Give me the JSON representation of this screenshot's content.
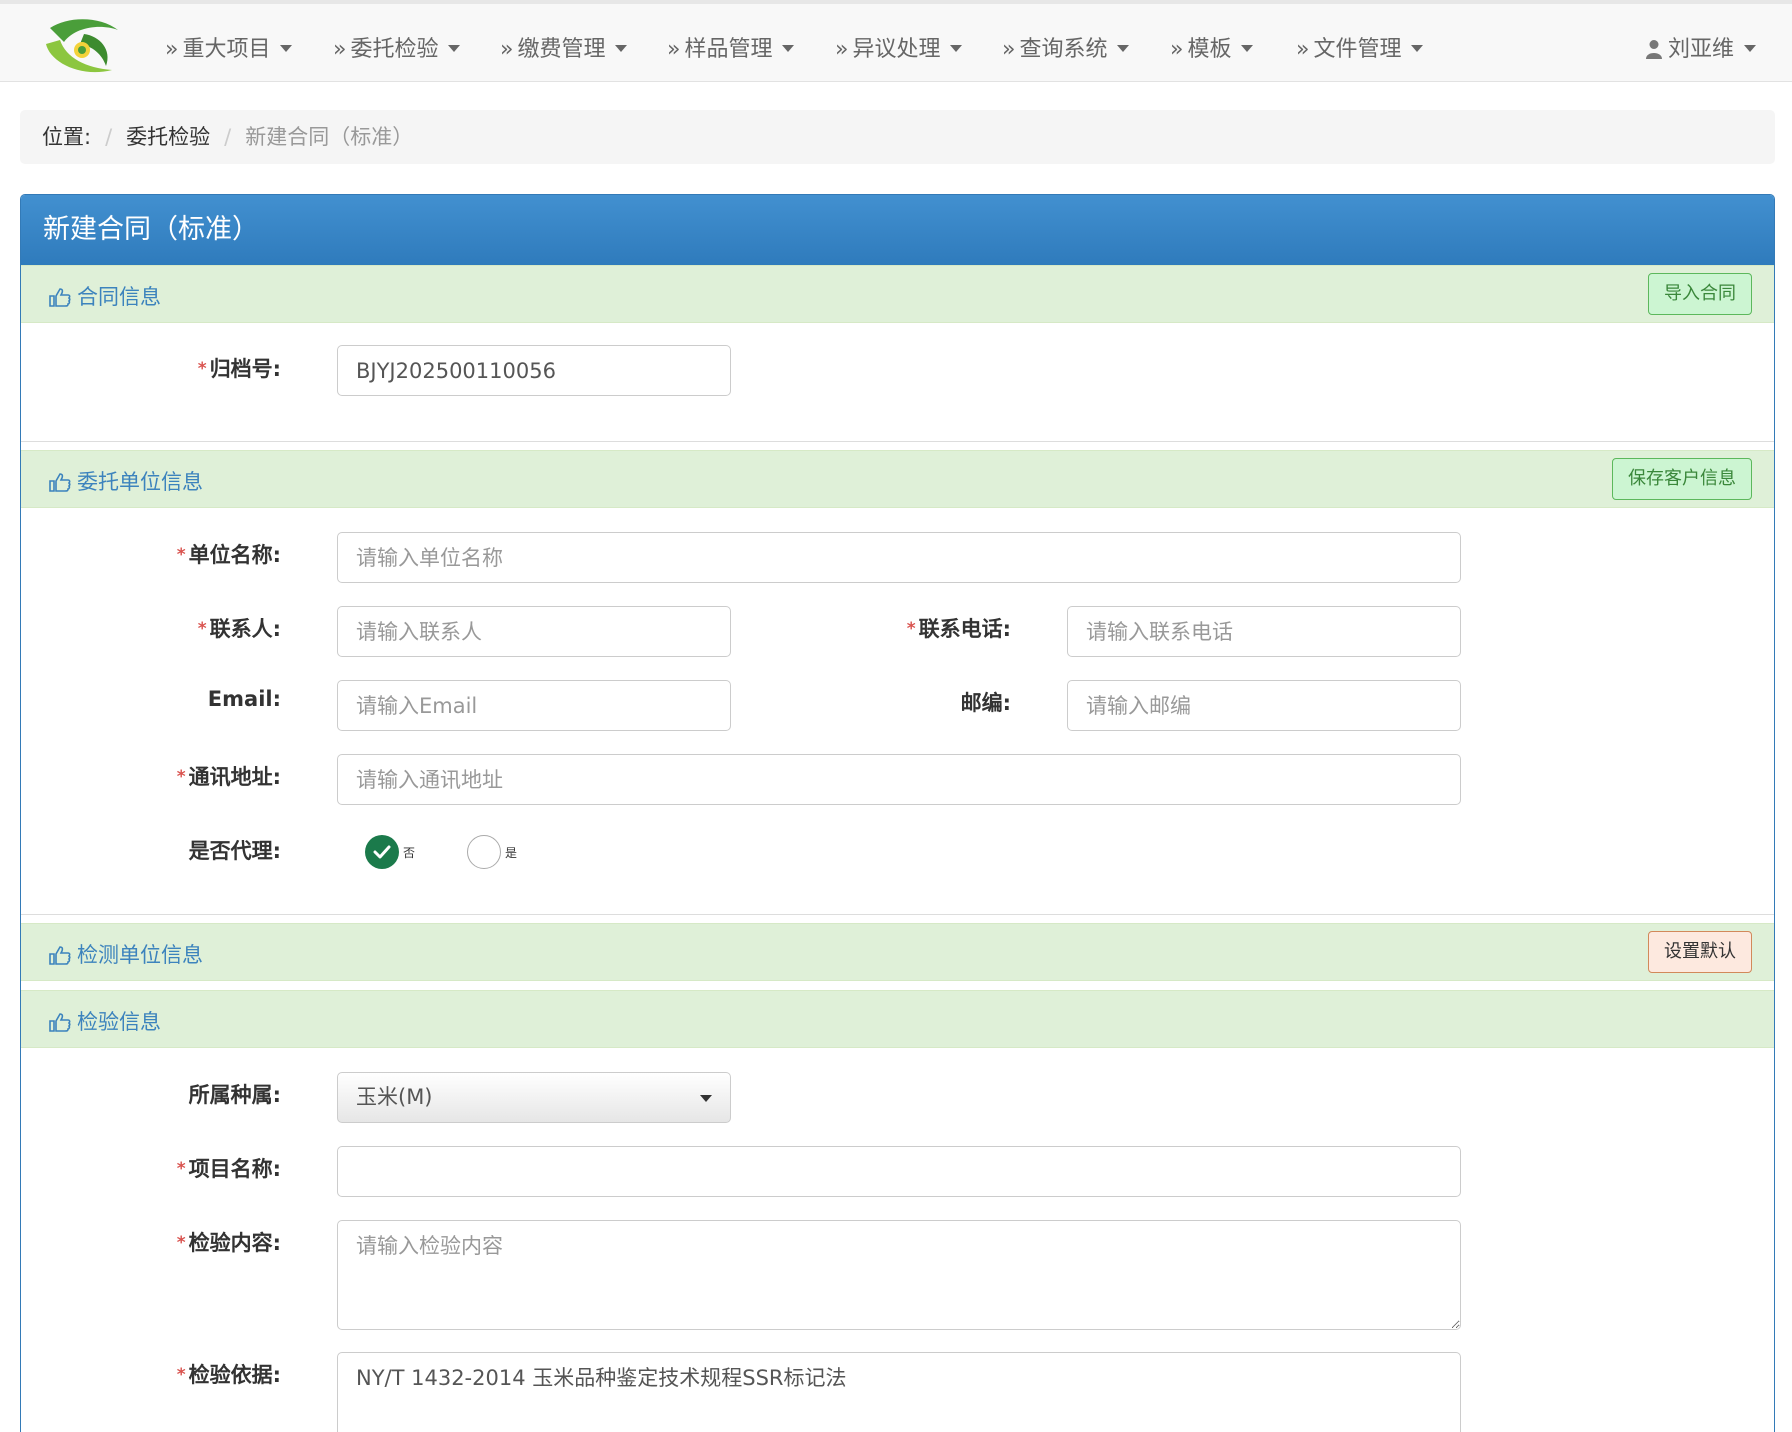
{
  "navbar": {
    "items": [
      {
        "label": "重大项目"
      },
      {
        "label": "委托检验"
      },
      {
        "label": "缴费管理"
      },
      {
        "label": "样品管理"
      },
      {
        "label": "异议处理"
      },
      {
        "label": "查询系统"
      },
      {
        "label": "模板"
      },
      {
        "label": "文件管理"
      }
    ],
    "prefix": "»",
    "user": "刘亚维"
  },
  "breadcrumb": {
    "position_label": "位置:",
    "separator": "/",
    "link": "委托检验",
    "current": "新建合同（标准）"
  },
  "panel": {
    "title": "新建合同（标准）"
  },
  "sections": {
    "contract": {
      "title": "合同信息",
      "button": "导入合同",
      "archive_label": "归档号:",
      "archive_value": "BJYJ202500110056"
    },
    "client": {
      "title": "委托单位信息",
      "button": "保存客户信息",
      "unit_name_label": "单位名称:",
      "unit_name_placeholder": "请输入单位名称",
      "contact_label": "联系人:",
      "contact_placeholder": "请输入联系人",
      "phone_label": "联系电话:",
      "phone_placeholder": "请输入联系电话",
      "email_label": "Email:",
      "email_placeholder": "请输入Email",
      "zip_label": "邮编:",
      "zip_placeholder": "请输入邮编",
      "address_label": "通讯地址:",
      "address_placeholder": "请输入通讯地址",
      "agent_label": "是否代理:",
      "agent_options": [
        {
          "label": "否",
          "selected": true
        },
        {
          "label": "是",
          "selected": false
        }
      ]
    },
    "lab": {
      "title": "检测单位信息",
      "button": "设置默认"
    },
    "inspection": {
      "title": "检验信息",
      "species_label": "所属种属:",
      "species_value": "玉米(M)",
      "project_label": "项目名称:",
      "project_value": "",
      "content_label": "检验内容:",
      "content_placeholder": "请输入检验内容",
      "basis_label": "检验依据:",
      "basis_value": "NY/T 1432-2014 玉米品种鉴定技术规程SSR标记法"
    }
  },
  "colors": {
    "primary": "#337ab7",
    "section_bg": "#dff0d8",
    "required": "#d9534f",
    "radio_checked": "#1b7a4b"
  }
}
